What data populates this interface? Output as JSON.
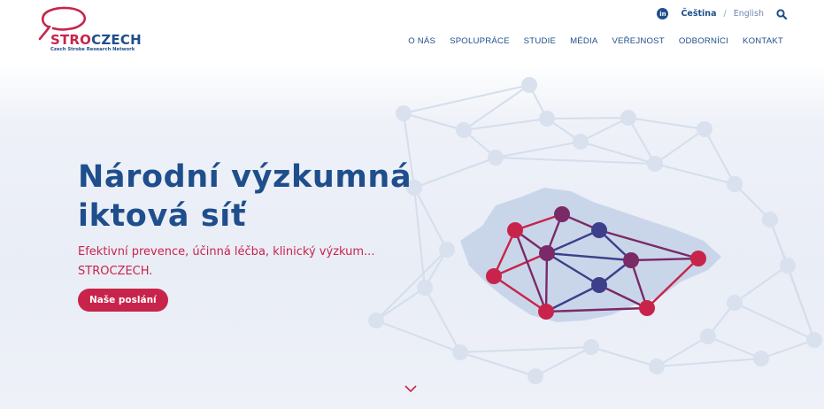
{
  "brand": {
    "name_part1": "STRO",
    "name_part2": "CZECH",
    "tagline": "Czech Stroke Research Network"
  },
  "topbar": {
    "linkedin_icon_text": "in",
    "lang_active": "Čeština",
    "lang_separator": "/",
    "lang_other": "English"
  },
  "nav": {
    "items": [
      {
        "label": "O NÁS"
      },
      {
        "label": "SPOLUPRÁCE"
      },
      {
        "label": "STUDIE"
      },
      {
        "label": "MÉDIA"
      },
      {
        "label": "VEŘEJNOST"
      },
      {
        "label": "ODBORNÍCI"
      },
      {
        "label": "KONTAKT"
      }
    ]
  },
  "hero": {
    "title_line1": "Národní výzkumná",
    "title_line2": "iktová síť",
    "subtitle_line1": "Efektivní prevence, účinná léčba, klinický výzkum...",
    "subtitle_line2": "STROCZECH.",
    "cta_label": "Naše poslání"
  },
  "colors": {
    "brand_blue": "#1f4e8c",
    "brand_red": "#c8244b",
    "map_fill": "#c9d6ea",
    "faint_network": "#d5deec",
    "node_purple": "#7a2a66",
    "node_indigo": "#3e3f8a"
  },
  "icons": {
    "linkedin": "linkedin-icon",
    "search": "search-icon",
    "scroll": "chevron-down-icon"
  }
}
